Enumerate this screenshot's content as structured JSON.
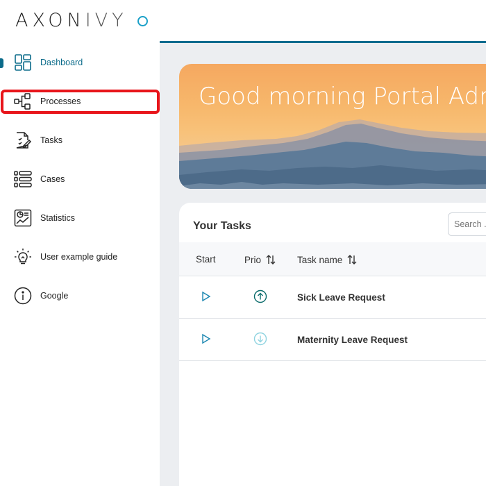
{
  "logo": {
    "brand_a": "AXON",
    "brand_b": "IVY"
  },
  "sidebar": {
    "items": [
      {
        "label": "Dashboard",
        "icon": "dashboard-icon"
      },
      {
        "label": "Processes",
        "icon": "processes-icon"
      },
      {
        "label": "Tasks",
        "icon": "tasks-icon"
      },
      {
        "label": "Cases",
        "icon": "cases-icon"
      },
      {
        "label": "Statistics",
        "icon": "statistics-icon"
      },
      {
        "label": "User example guide",
        "icon": "lightbulb-icon"
      },
      {
        "label": "Google",
        "icon": "info-icon"
      }
    ],
    "active_index": 0,
    "highlighted_index": 1
  },
  "banner": {
    "greeting": "Good morning Portal Admin"
  },
  "tasks_widget": {
    "title": "Your Tasks",
    "search_placeholder": "Search ...",
    "columns": {
      "start": "Start",
      "prio": "Prio",
      "task_name": "Task name"
    },
    "rows": [
      {
        "name": "Sick Leave Request",
        "priority": "high"
      },
      {
        "name": "Maternity Leave Request",
        "priority": "low"
      }
    ]
  },
  "colors": {
    "accent": "#0f6c8f",
    "highlight": "#e8151b",
    "start_icon": "#1a86b0",
    "prio_high": "#0b6b6b",
    "prio_low": "#8fd3e0"
  }
}
